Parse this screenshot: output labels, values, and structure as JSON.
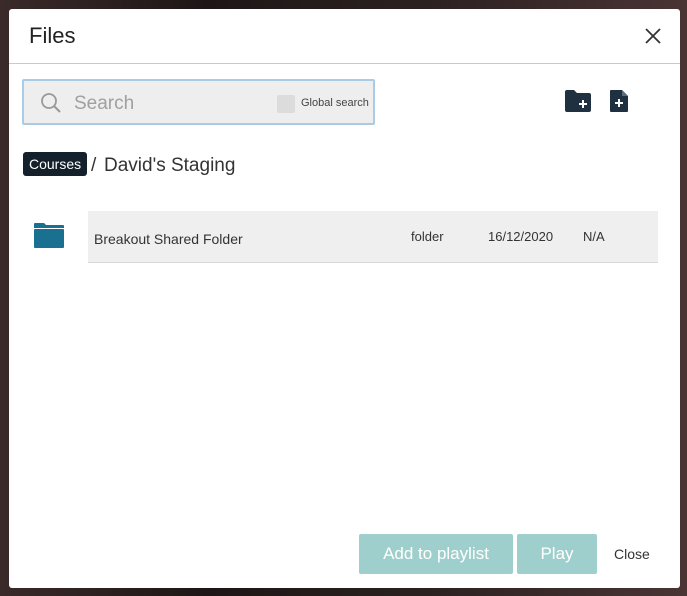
{
  "dialog": {
    "title": "Files",
    "close_icon": "close-icon"
  },
  "search": {
    "placeholder": "Search",
    "value": "",
    "global_search_label": "Global search",
    "global_search_checked": false
  },
  "toolbar": {
    "new_folder_icon": "folder-plus-icon",
    "new_file_icon": "file-plus-icon"
  },
  "breadcrumb": {
    "root": "Courses",
    "separator": "/",
    "current": "David's Staging"
  },
  "files": [
    {
      "icon": "folder-icon",
      "name": "Breakout Shared Folder",
      "type": "folder",
      "date": "16/12/2020",
      "size": "N/A"
    }
  ],
  "footer": {
    "add_to_playlist_label": "Add to playlist",
    "play_label": "Play",
    "close_label": "Close"
  },
  "colors": {
    "accent": "#9fcfcc",
    "breadcrumb_bg": "#14202b",
    "folder": "#1a7090",
    "toolbar_icon": "#1f3140",
    "search_border": "#a9cbe6"
  }
}
